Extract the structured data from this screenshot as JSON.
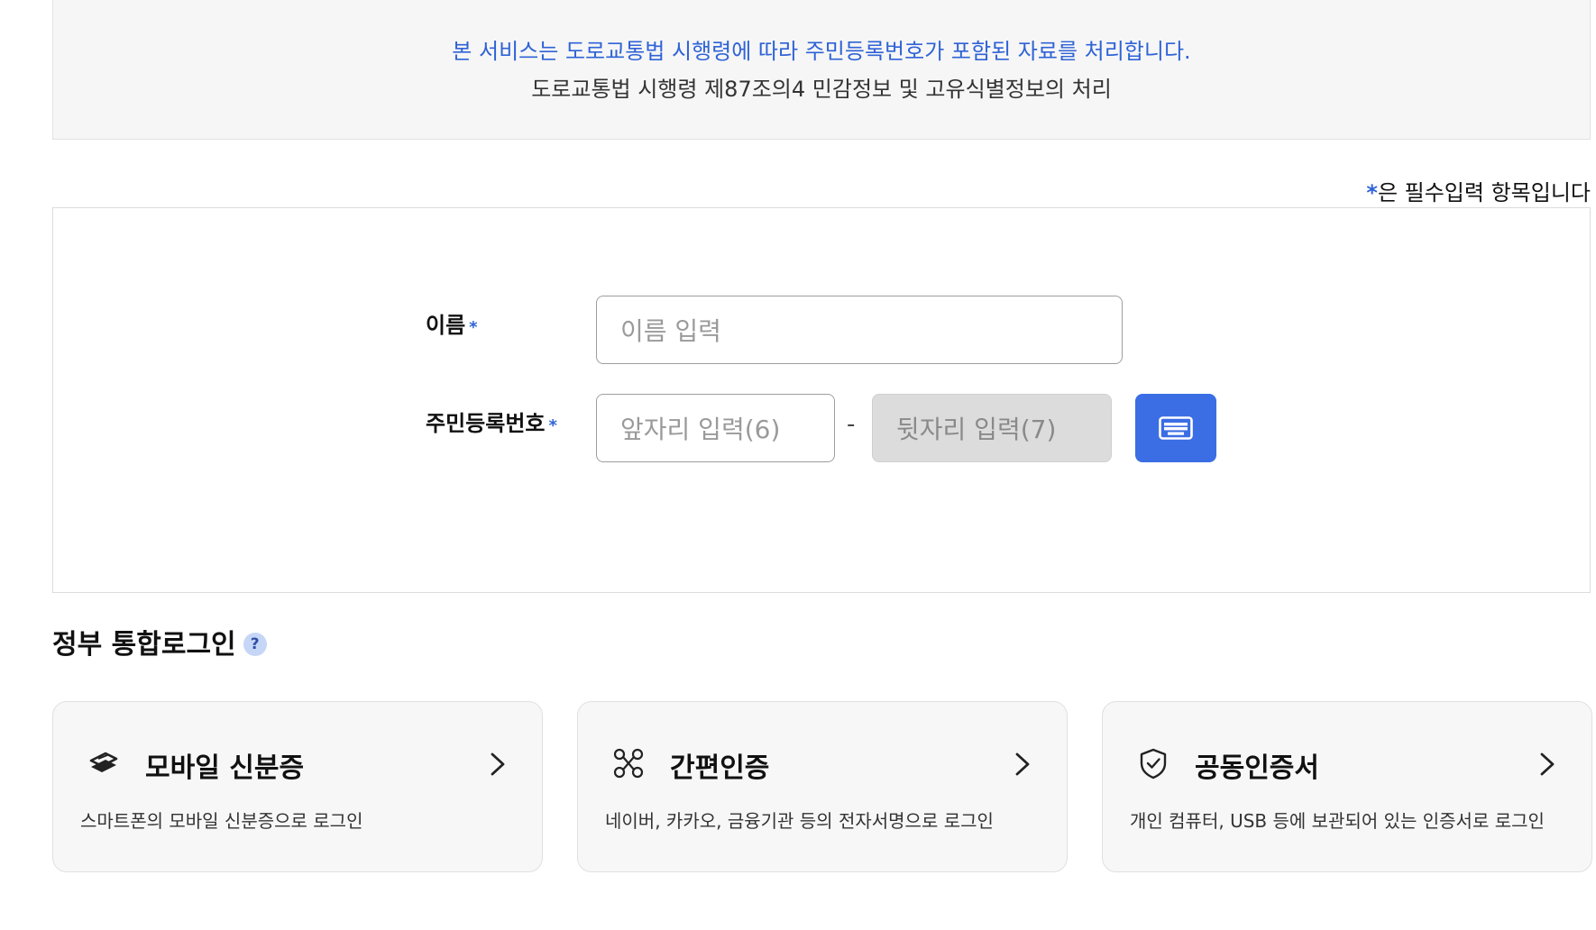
{
  "notice": {
    "line1": "본 서비스는 도로교통법 시행령에 따라 주민등록번호가 포함된 자료를 처리합니다.",
    "line2": "도로교통법 시행령 제87조의4 민감정보 및 고유식별정보의 처리"
  },
  "required_note": {
    "star": "*",
    "text": "은 필수입력 항목입니다"
  },
  "form": {
    "name_label": "이름",
    "name_placeholder": "이름 입력",
    "rrn_label": "주민등록번호",
    "rrn_front_placeholder": "앞자리 입력(6)",
    "rrn_separator": "-",
    "rrn_back_placeholder": "뒷자리 입력(7)",
    "required_star": "*",
    "keypad_icon": "keyboard-icon"
  },
  "gov_login": {
    "title": "정부 통합로그인",
    "help_glyph": "?",
    "cards": [
      {
        "icon": "mobile-id-icon",
        "title": "모바일 신분증",
        "desc": "스마트폰의 모바일 신분증으로 로그인"
      },
      {
        "icon": "simple-auth-icon",
        "title": "간편인증",
        "desc": "네이버, 카카오, 금융기관 등의 전자서명으로 로그인"
      },
      {
        "icon": "shield-check-icon",
        "title": "공동인증서",
        "desc": "개인 컴퓨터, USB 등에 보관되어 있는 인증서로 로그인"
      }
    ]
  },
  "colors": {
    "accent": "#3b6ee4",
    "notice_blue": "#2f63d6",
    "panel_bg": "#f6f6f6"
  }
}
